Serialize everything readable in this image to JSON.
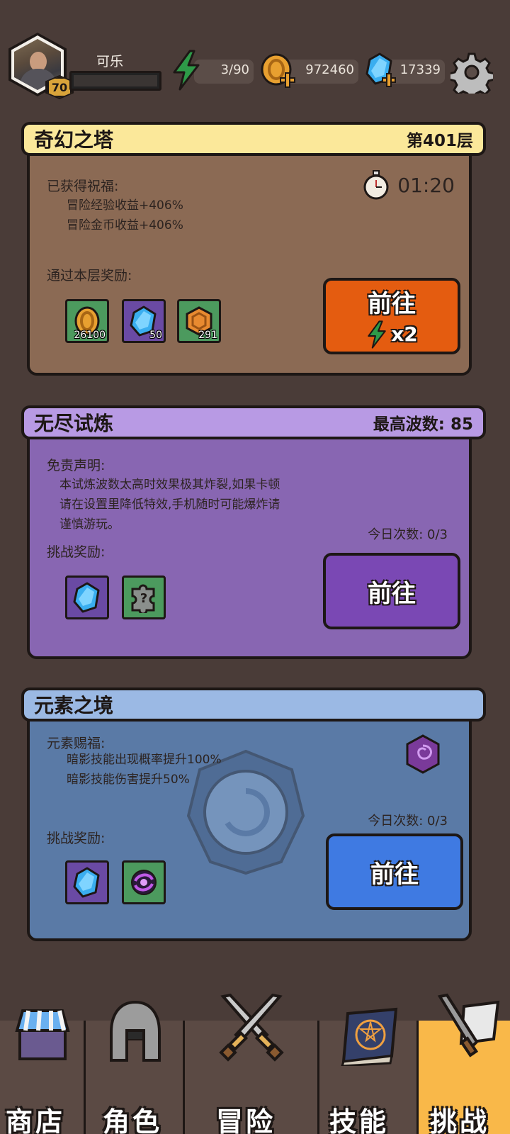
{
  "player": {
    "name": "可乐",
    "level": "70",
    "xp_progress": 0.0
  },
  "resources": {
    "energy": "3/90",
    "gold": "972460",
    "gems": "17339"
  },
  "tower": {
    "title": "奇幻之塔",
    "floor": "第401层",
    "blessing_label": "已获得祝福:",
    "blessings": [
      "冒险经验收益+406%",
      "冒险金币收益+406%"
    ],
    "timer": "01:20",
    "reward_label": "通过本层奖励:",
    "rewards": [
      {
        "icon": "gold-coin-icon",
        "count": "26100"
      },
      {
        "icon": "blue-gem-icon",
        "count": "50"
      },
      {
        "icon": "bronze-token-icon",
        "count": "291"
      }
    ],
    "go_label": "前往",
    "cost_label": "x2"
  },
  "endless": {
    "title": "无尽试炼",
    "best_wave": "最高波数: 85",
    "disclaimer_label": "免责声明:",
    "disclaimer_lines": [
      "本试炼波数太高时效果极其炸裂,如果卡顿",
      "请在设置里降低特效,手机随时可能爆炸请",
      "谨慎游玩。"
    ],
    "today_count": "今日次数: 0/3",
    "reward_label": "挑战奖励:",
    "rewards": [
      {
        "icon": "blue-gem-icon"
      },
      {
        "icon": "mystery-puzzle-icon"
      }
    ],
    "go_label": "前往"
  },
  "element": {
    "title": "元素之境",
    "blessing_label": "元素赐福:",
    "blessings": [
      "暗影技能出现概率提升100%",
      "暗影技能伤害提升50%"
    ],
    "element_icon": "shadow-element-icon",
    "today_count": "今日次数: 0/3",
    "reward_label": "挑战奖励:",
    "rewards": [
      {
        "icon": "blue-gem-icon"
      },
      {
        "icon": "shadow-vortex-icon"
      }
    ],
    "go_label": "前往"
  },
  "nav": {
    "tabs": [
      {
        "label": "商店",
        "icon": "shop-icon"
      },
      {
        "label": "角色",
        "icon": "helmet-icon"
      },
      {
        "label": "冒险",
        "icon": "crossed-swords-icon"
      },
      {
        "label": "技能",
        "icon": "spellbook-icon"
      },
      {
        "label": "挑战",
        "icon": "challenge-flag-icon"
      }
    ],
    "active": "挑战"
  },
  "colors": {
    "background": "#4a3c38",
    "tower_card": "#8b6a54",
    "tower_header": "#fbe89a",
    "endless_card": "#8866b2",
    "endless_header": "#b89ae4",
    "element_card": "#5a7aa6",
    "element_header": "#9bb9e4",
    "btn_orange": "#e45c10",
    "btn_purple": "#7a48b4",
    "btn_blue": "#3f7ae2",
    "nav_active": "#f9b849"
  }
}
